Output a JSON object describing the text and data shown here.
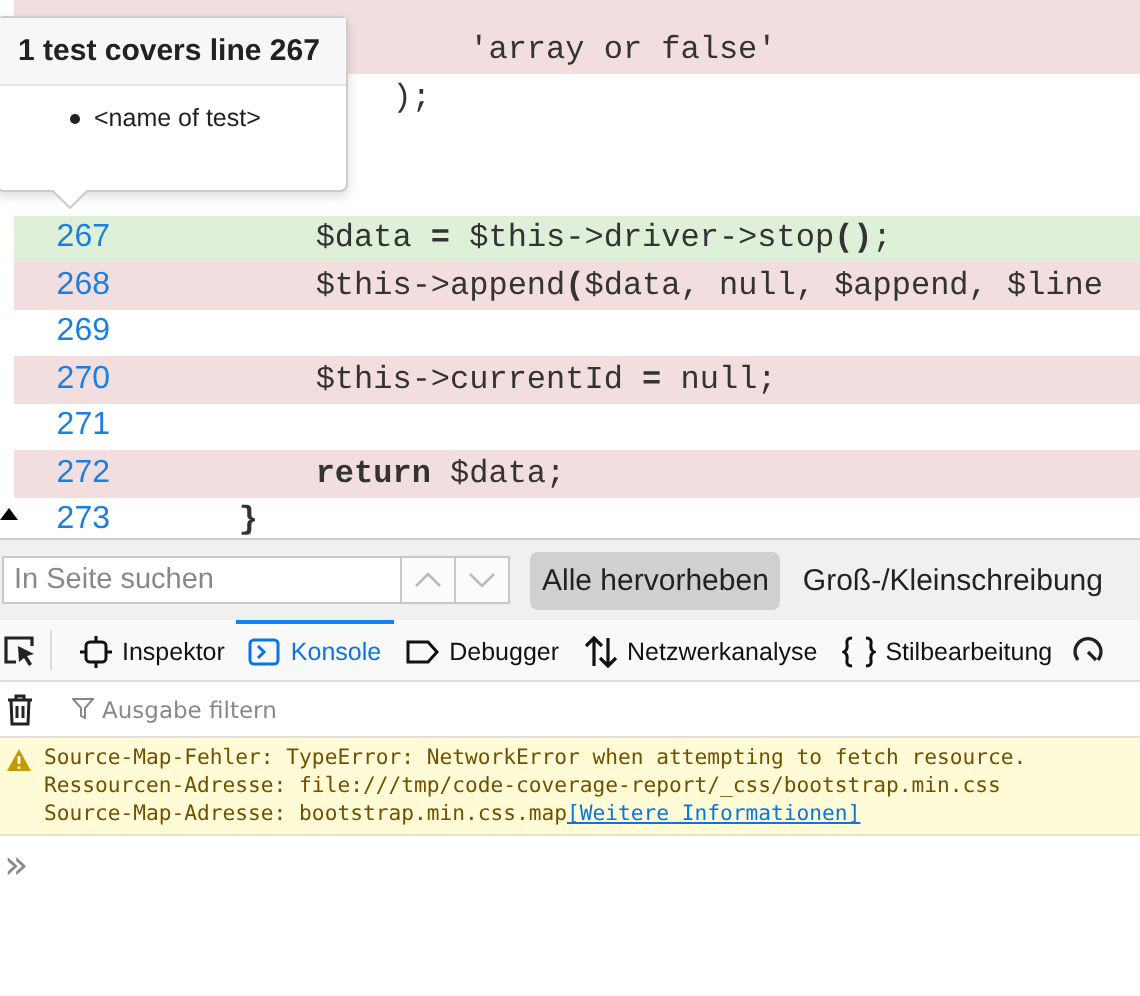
{
  "code_lines": [
    {
      "kind": "uncovered"
    },
    {
      "code": "                'array or false'",
      "kind": "uncovered"
    },
    {
      "code": "            );",
      "kind": "plain"
    },
    {
      "kind": "plain"
    },
    {
      "kind": "plain"
    },
    {
      "number": "267",
      "code": "        $data **=** $this->driver->stop**()**;",
      "kind": "covered"
    },
    {
      "number": "268",
      "code": "        $this->append**(**$data, null, $append, $line",
      "kind": "uncovered"
    },
    {
      "number": "269",
      "kind": "plain"
    },
    {
      "number": "270",
      "code": "        $this->currentId **=** null;",
      "kind": "uncovered"
    },
    {
      "number": "271",
      "kind": "plain"
    },
    {
      "number": "272",
      "code": "        **return** $data;",
      "kind": "uncovered"
    },
    {
      "number": "273",
      "code": "    **}**",
      "kind": "plain"
    }
  ],
  "popover": {
    "title": "1 test covers line 267",
    "items": [
      "<name of test>"
    ]
  },
  "find_bar": {
    "placeholder": "In Seite suchen",
    "previous_disabled": true,
    "next_disabled": true,
    "options": [
      {
        "label": "Alle hervorheben",
        "selected": true
      },
      {
        "label": "Groß-/Kleinschreibung",
        "selected": false
      }
    ]
  },
  "devtools_tabs": [
    {
      "label": "Inspektor",
      "selected": false
    },
    {
      "label": "Konsole",
      "selected": true
    },
    {
      "label": "Debugger",
      "selected": false
    },
    {
      "label": "Netzwerkanalyse",
      "selected": false
    },
    {
      "label": "Stilbearbeitung",
      "selected": false
    }
  ],
  "console_filter": {
    "placeholder": "Ausgabe filtern"
  },
  "messages": [
    {
      "kind": "warning",
      "lines": [
        "Source-Map-Fehler: TypeError: NetworkError when attempting to fetch resource.",
        "Ressourcen-Adresse: file:///tmp/code-coverage-report/_css/bootstrap.min.css",
        "Source-Map-Adresse: bootstrap.min.css.map"
      ],
      "link": "[Weitere Informationen]"
    }
  ],
  "prompt": "»"
}
